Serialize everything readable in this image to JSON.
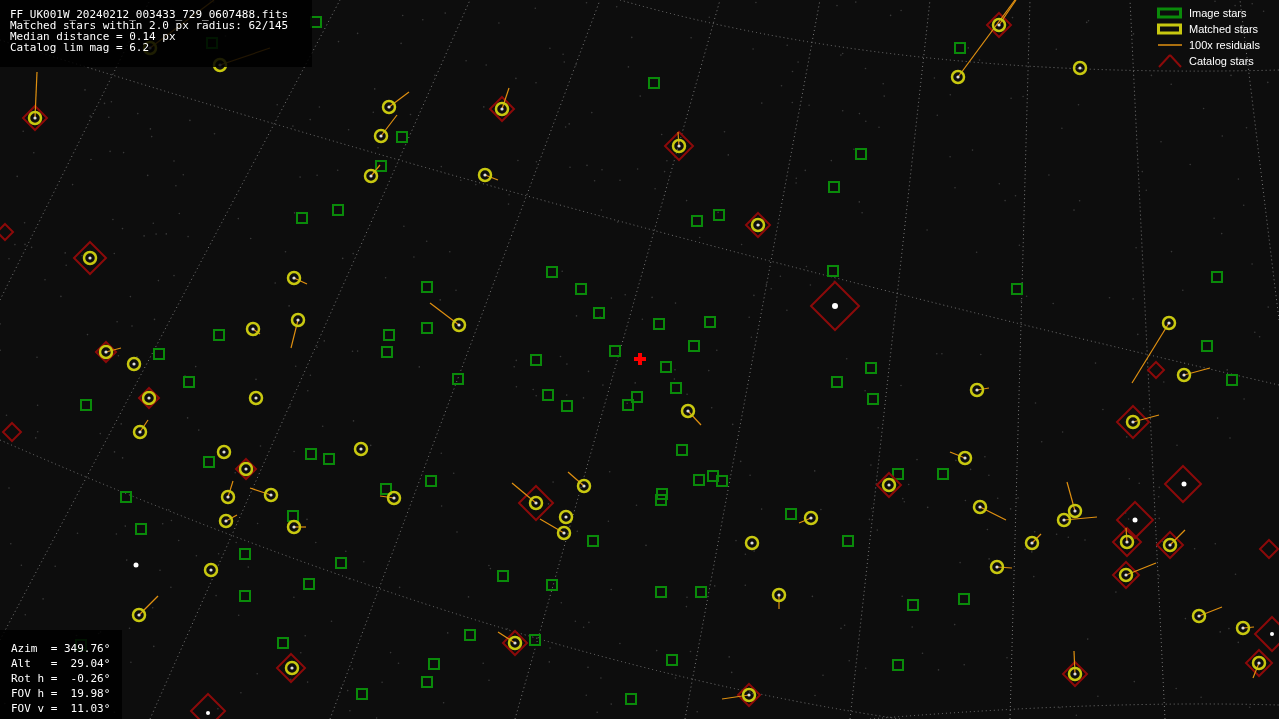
{
  "info": [
    "FF_UK001W_20240212_003433_729_0607488.fits",
    "Matched stars within 2.0 px radius: 62/145",
    "Median distance = 0.14 px",
    "Catalog lim mag = 6.2"
  ],
  "legend": [
    {
      "kind": "image",
      "label": "Image stars"
    },
    {
      "kind": "matched",
      "label": "Matched stars"
    },
    {
      "kind": "residual",
      "label": "100x residuals"
    },
    {
      "kind": "catalog",
      "label": "Catalog stars"
    }
  ],
  "pointing": [
    "Azim  = 349.76°",
    "Alt   =  29.04°",
    "Rot h =  -0.26°",
    "FOV h =  19.98°",
    "FOV v =  11.03°"
  ]
}
